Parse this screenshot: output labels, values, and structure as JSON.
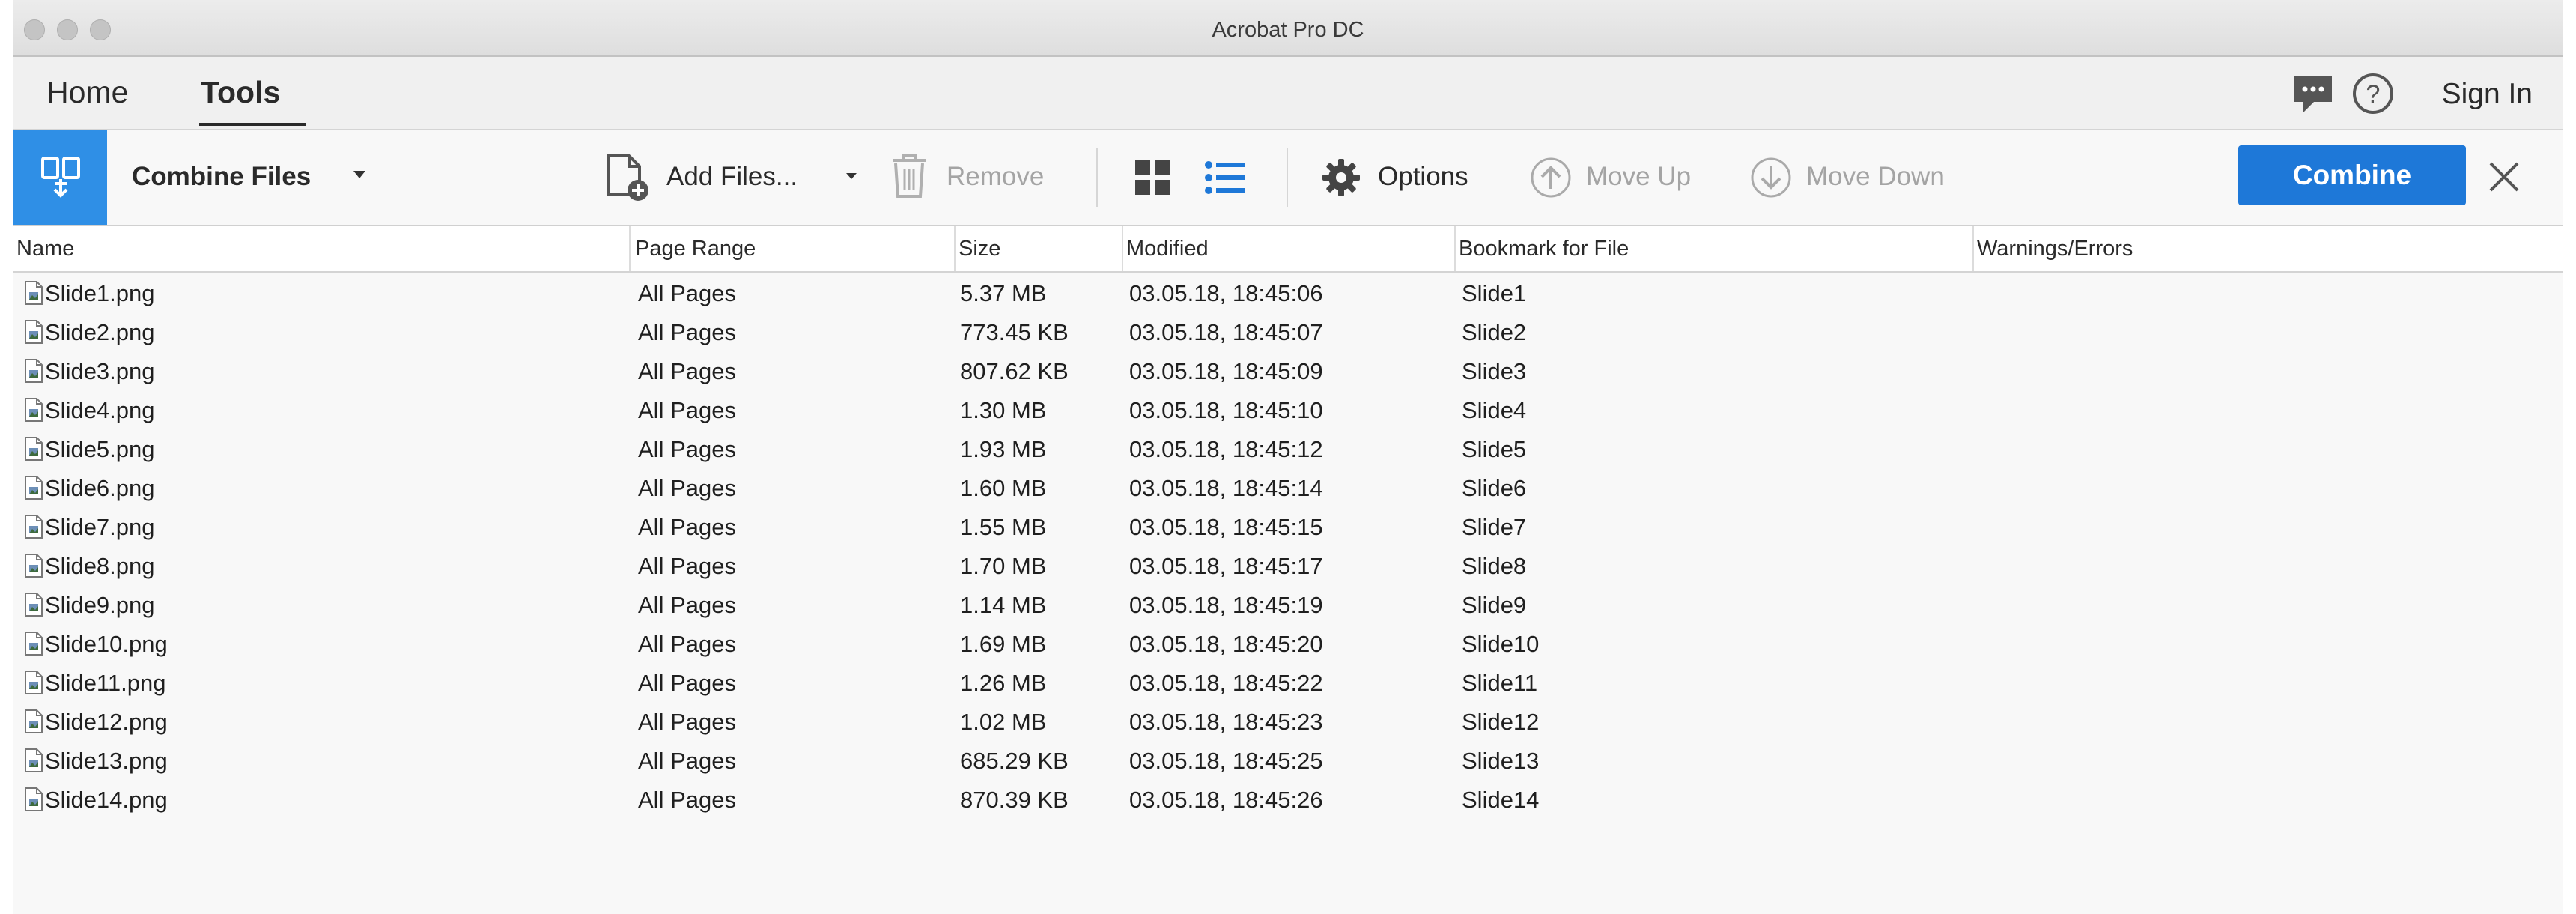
{
  "window": {
    "title": "Acrobat Pro DC"
  },
  "tabs": [
    {
      "label": "Home"
    },
    {
      "label": "Tools"
    }
  ],
  "header": {
    "sign_in": "Sign In"
  },
  "toolbar": {
    "tool_name": "Combine Files",
    "add_files": "Add Files...",
    "remove": "Remove",
    "options": "Options",
    "move_up": "Move Up",
    "move_down": "Move Down",
    "combine": "Combine"
  },
  "table": {
    "columns": [
      "Name",
      "Page Range",
      "Size",
      "Modified",
      "Bookmark for File",
      "Warnings/Errors"
    ],
    "rows": [
      {
        "name": "Slide1.png",
        "range": "All Pages",
        "size": "5.37 MB",
        "modified": "03.05.18, 18:45:06",
        "bookmark": "Slide1"
      },
      {
        "name": "Slide2.png",
        "range": "All Pages",
        "size": "773.45 KB",
        "modified": "03.05.18, 18:45:07",
        "bookmark": "Slide2"
      },
      {
        "name": "Slide3.png",
        "range": "All Pages",
        "size": "807.62 KB",
        "modified": "03.05.18, 18:45:09",
        "bookmark": "Slide3"
      },
      {
        "name": "Slide4.png",
        "range": "All Pages",
        "size": "1.30 MB",
        "modified": "03.05.18, 18:45:10",
        "bookmark": "Slide4"
      },
      {
        "name": "Slide5.png",
        "range": "All Pages",
        "size": "1.93 MB",
        "modified": "03.05.18, 18:45:12",
        "bookmark": "Slide5"
      },
      {
        "name": "Slide6.png",
        "range": "All Pages",
        "size": "1.60 MB",
        "modified": "03.05.18, 18:45:14",
        "bookmark": "Slide6"
      },
      {
        "name": "Slide7.png",
        "range": "All Pages",
        "size": "1.55 MB",
        "modified": "03.05.18, 18:45:15",
        "bookmark": "Slide7"
      },
      {
        "name": "Slide8.png",
        "range": "All Pages",
        "size": "1.70 MB",
        "modified": "03.05.18, 18:45:17",
        "bookmark": "Slide8"
      },
      {
        "name": "Slide9.png",
        "range": "All Pages",
        "size": "1.14 MB",
        "modified": "03.05.18, 18:45:19",
        "bookmark": "Slide9"
      },
      {
        "name": "Slide10.png",
        "range": "All Pages",
        "size": "1.69 MB",
        "modified": "03.05.18, 18:45:20",
        "bookmark": "Slide10"
      },
      {
        "name": "Slide11.png",
        "range": "All Pages",
        "size": "1.26 MB",
        "modified": "03.05.18, 18:45:22",
        "bookmark": "Slide11"
      },
      {
        "name": "Slide12.png",
        "range": "All Pages",
        "size": "1.02 MB",
        "modified": "03.05.18, 18:45:23",
        "bookmark": "Slide12"
      },
      {
        "name": "Slide13.png",
        "range": "All Pages",
        "size": "685.29 KB",
        "modified": "03.05.18, 18:45:25",
        "bookmark": "Slide13"
      },
      {
        "name": "Slide14.png",
        "range": "All Pages",
        "size": "870.39 KB",
        "modified": "03.05.18, 18:45:26",
        "bookmark": "Slide14"
      }
    ]
  },
  "colors": {
    "accent": "#1e78d8",
    "tool_tile": "#2f8fe6"
  },
  "icons": [
    "combine-files-icon",
    "add-file-icon",
    "trash-icon",
    "grid-view-icon",
    "list-view-icon",
    "gear-icon",
    "arrow-up-circle-icon",
    "arrow-down-circle-icon",
    "close-icon",
    "comment-icon",
    "help-icon",
    "image-file-icon"
  ]
}
